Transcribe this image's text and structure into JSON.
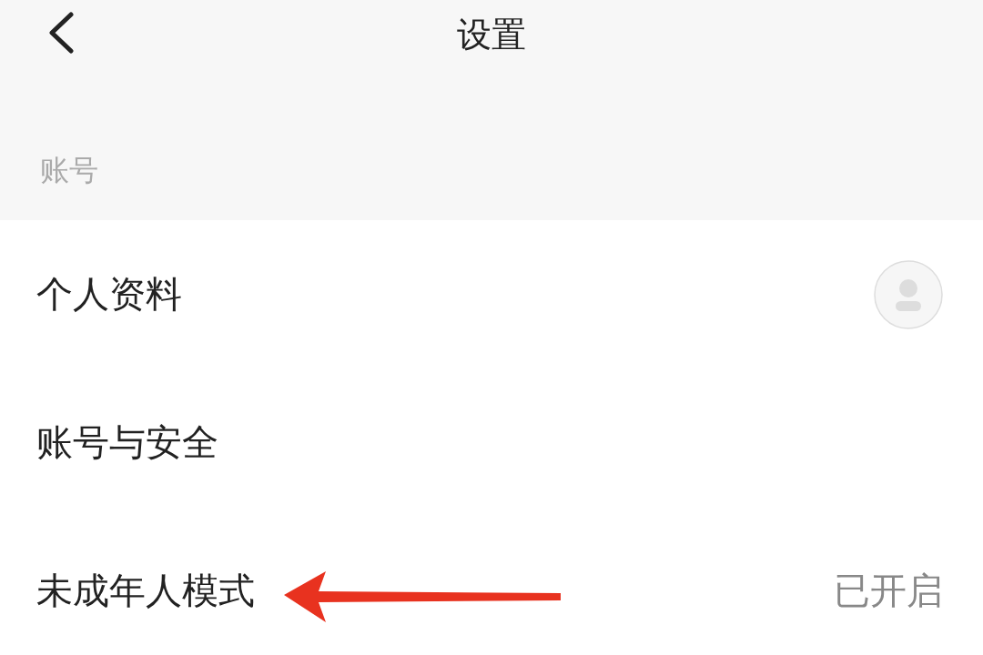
{
  "header": {
    "title": "设置"
  },
  "section": {
    "label": "账号"
  },
  "items": [
    {
      "kind": "avatar",
      "label": "个人资料"
    },
    {
      "kind": "plain",
      "label": "账号与安全"
    },
    {
      "kind": "value",
      "label": "未成年人模式",
      "value": "已开启"
    }
  ]
}
